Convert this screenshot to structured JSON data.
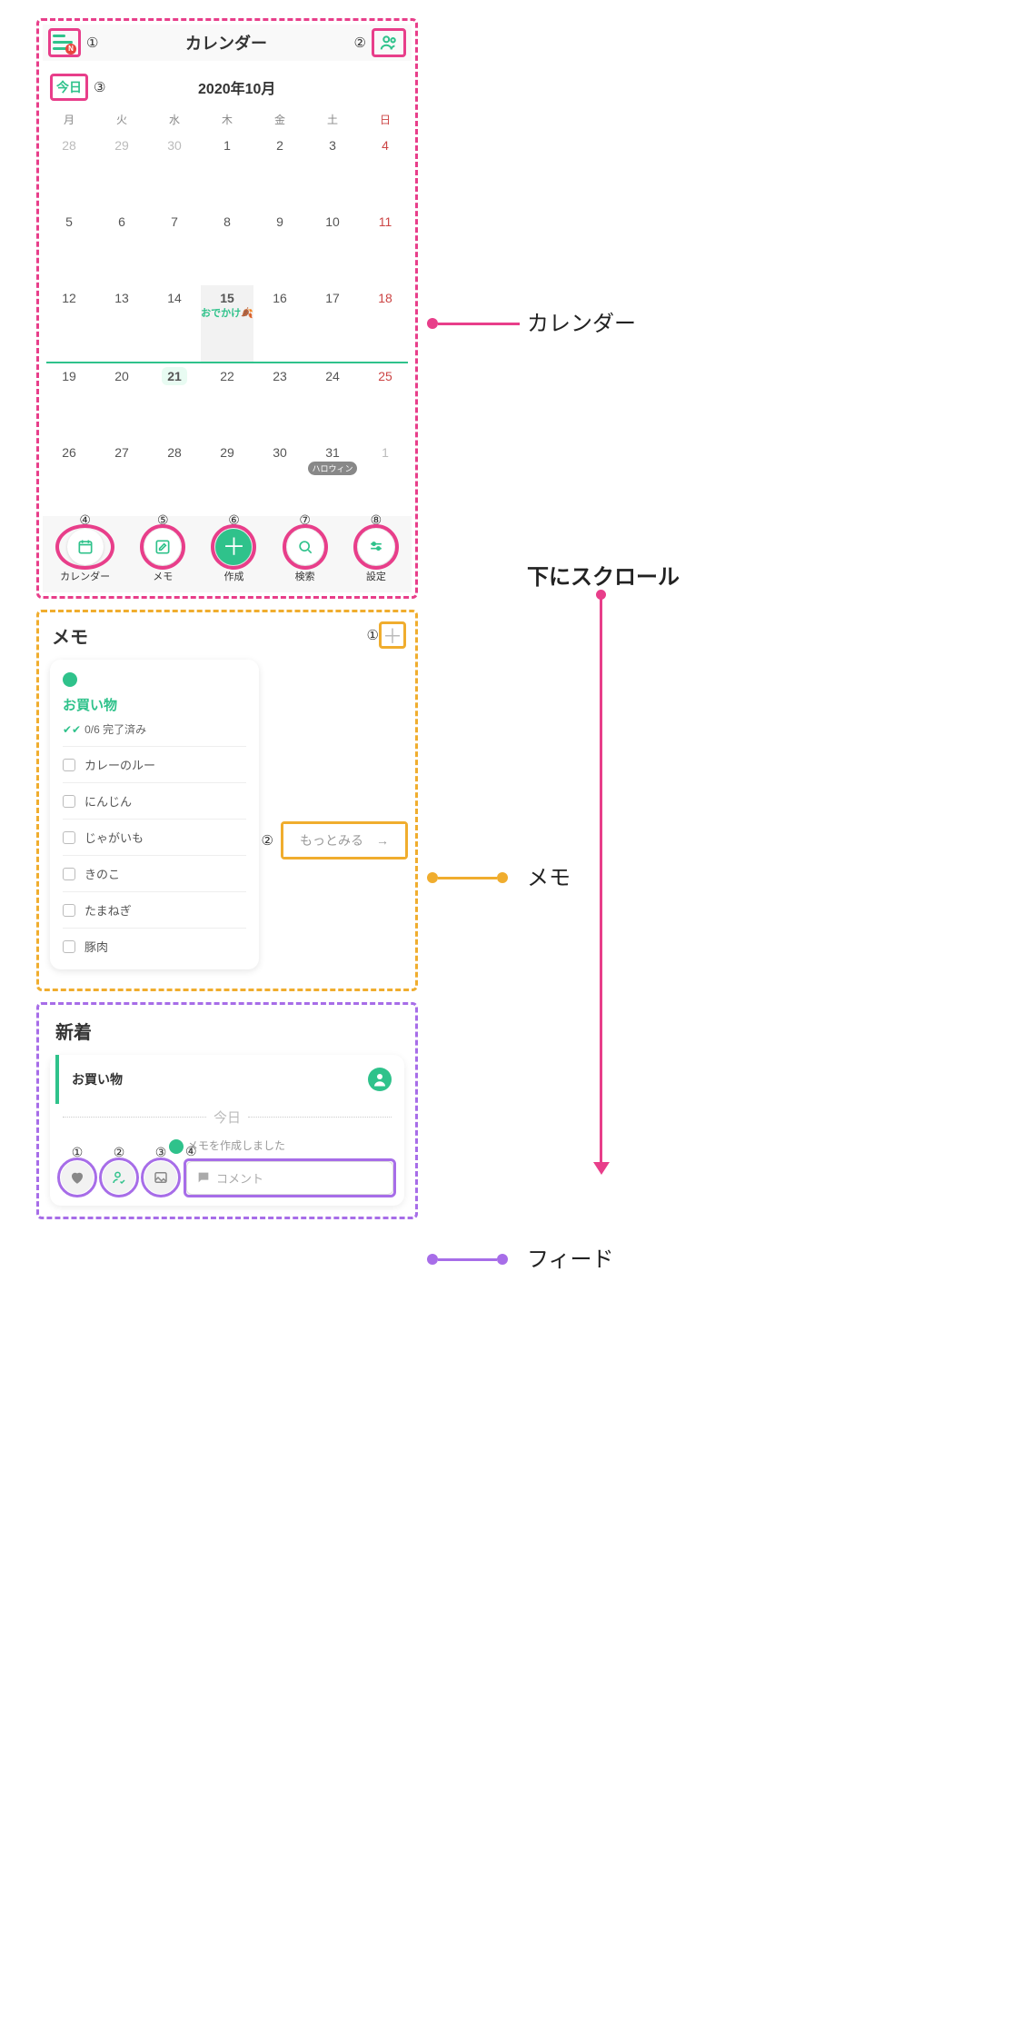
{
  "header": {
    "title": "カレンダー",
    "menu_badge": "N"
  },
  "calendar": {
    "today_label": "今日",
    "month_label": "2020年10月",
    "dow": [
      "月",
      "火",
      "水",
      "木",
      "金",
      "土",
      "日"
    ],
    "weeks": [
      [
        {
          "n": "28",
          "cls": "prev"
        },
        {
          "n": "29",
          "cls": "prev"
        },
        {
          "n": "30",
          "cls": "prev"
        },
        {
          "n": "1"
        },
        {
          "n": "2"
        },
        {
          "n": "3"
        },
        {
          "n": "4",
          "cls": "sun"
        }
      ],
      [
        {
          "n": "5"
        },
        {
          "n": "6"
        },
        {
          "n": "7"
        },
        {
          "n": "8"
        },
        {
          "n": "9"
        },
        {
          "n": "10"
        },
        {
          "n": "11",
          "cls": "sun"
        }
      ],
      [
        {
          "n": "12"
        },
        {
          "n": "13"
        },
        {
          "n": "14"
        },
        {
          "n": "15",
          "cls": "selected",
          "evt": "おでかけ🍂"
        },
        {
          "n": "16"
        },
        {
          "n": "17"
        },
        {
          "n": "18",
          "cls": "sun"
        }
      ],
      [
        {
          "n": "19"
        },
        {
          "n": "20"
        },
        {
          "n": "21",
          "cls": "today"
        },
        {
          "n": "22"
        },
        {
          "n": "23"
        },
        {
          "n": "24"
        },
        {
          "n": "25",
          "cls": "sun"
        }
      ],
      [
        {
          "n": "26"
        },
        {
          "n": "27"
        },
        {
          "n": "28"
        },
        {
          "n": "29"
        },
        {
          "n": "30"
        },
        {
          "n": "31",
          "badge": "ハロウィン"
        },
        {
          "n": "1",
          "cls": "next"
        }
      ]
    ]
  },
  "bottom_nav": {
    "items": [
      {
        "label": "カレンダー",
        "icon": "calendar"
      },
      {
        "label": "メモ",
        "icon": "edit"
      },
      {
        "label": "作成",
        "icon": "plus",
        "primary": true
      },
      {
        "label": "検索",
        "icon": "search"
      },
      {
        "label": "設定",
        "icon": "sliders"
      }
    ]
  },
  "memo": {
    "heading": "メモ",
    "card": {
      "title": "お買い物",
      "progress": "0/6 完了済み",
      "items": [
        "カレーのルー",
        "にんじん",
        "じゃがいも",
        "きのこ",
        "たまねぎ",
        "豚肉"
      ]
    },
    "more_label": "もっとみる"
  },
  "feed": {
    "heading": "新着",
    "item_title": "お買い物",
    "divider": "今日",
    "made_text": "メモを作成しました",
    "comment_placeholder": "コメント"
  },
  "side": {
    "cal": "カレンダー",
    "memo": "メモ",
    "feed": "フィード",
    "scroll": "下にスクロール"
  },
  "anno_nums": {
    "n1": "①",
    "n2": "②",
    "n3": "③",
    "n4": "④",
    "n5": "⑤",
    "n6": "⑥",
    "n7": "⑦",
    "n8": "⑧"
  }
}
